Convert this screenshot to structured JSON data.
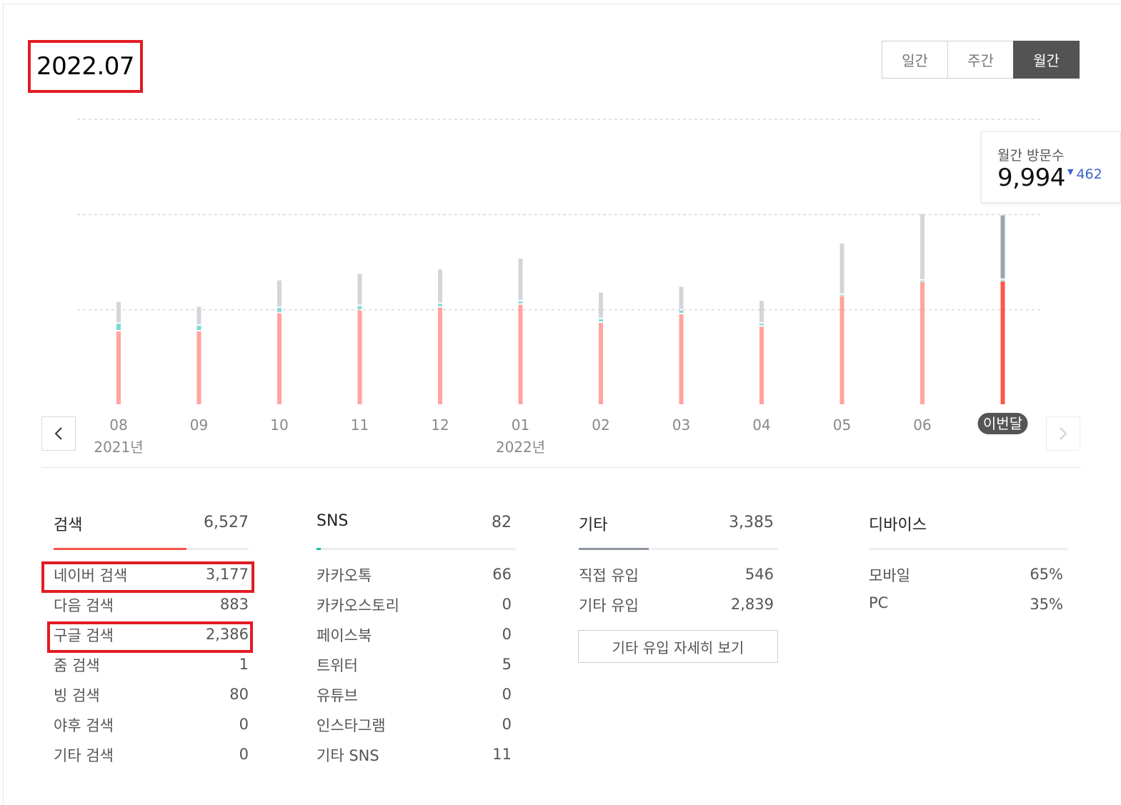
{
  "header": {
    "period": "2022.07",
    "tabs": [
      "일간",
      "주간",
      "월간"
    ],
    "active_tab": "월간"
  },
  "tooltip": {
    "title": "월간 방문수",
    "value": "9,994",
    "delta": "462"
  },
  "chart_data": {
    "type": "bar",
    "categories": [
      "08",
      "09",
      "10",
      "11",
      "12",
      "01",
      "02",
      "03",
      "04",
      "05",
      "06",
      "이번달"
    ],
    "year_labels": [
      {
        "text": "2021년",
        "category": "08"
      },
      {
        "text": "2022년",
        "category": "01"
      }
    ],
    "series": [
      {
        "key": "search",
        "color": "#ffa49e",
        "color_current": "#ff5549",
        "values": [
          3900,
          3900,
          4850,
          5000,
          5150,
          5300,
          4350,
          4800,
          4150,
          5750,
          6500,
          6527
        ]
      },
      {
        "key": "sns",
        "color": "#7ed8d4",
        "color_current": "#3dc9c1",
        "values": [
          400,
          300,
          280,
          230,
          200,
          170,
          190,
          200,
          160,
          70,
          70,
          82
        ]
      },
      {
        "key": "etc",
        "color": "#d2d6db",
        "color_current": "#9ba6b2",
        "values": [
          1150,
          1000,
          1450,
          1700,
          1800,
          2250,
          1400,
          1250,
          1200,
          2700,
          3500,
          3385
        ]
      }
    ],
    "current_index": 11,
    "ylim": [
      0,
      15000
    ],
    "grid_lines": [
      5000,
      10000,
      15000
    ],
    "grid": true
  },
  "categories": [
    {
      "name": "검색",
      "total": "6,527",
      "bar_color": "#f4544a",
      "bar_fraction": 0.68,
      "rows": [
        {
          "label": "네이버 검색",
          "value": "3,177"
        },
        {
          "label": "다음 검색",
          "value": "883"
        },
        {
          "label": "구글 검색",
          "value": "2,386"
        },
        {
          "label": "줌 검색",
          "value": "1"
        },
        {
          "label": "빙 검색",
          "value": "80"
        },
        {
          "label": "야후 검색",
          "value": "0"
        },
        {
          "label": "기타 검색",
          "value": "0"
        }
      ]
    },
    {
      "name": "SNS",
      "total": "82",
      "bar_color": "#1bbfa7",
      "bar_fraction": 0.022,
      "rows": [
        {
          "label": "카카오톡",
          "value": "66"
        },
        {
          "label": "카카오스토리",
          "value": "0"
        },
        {
          "label": "페이스북",
          "value": "0"
        },
        {
          "label": "트위터",
          "value": "5"
        },
        {
          "label": "유튜브",
          "value": "0"
        },
        {
          "label": "인스타그램",
          "value": "0"
        },
        {
          "label": "기타 SNS",
          "value": "11"
        }
      ]
    },
    {
      "name": "기타",
      "total": "3,385",
      "bar_color": "#8c949f",
      "bar_fraction": 0.35,
      "rows": [
        {
          "label": "직접 유입",
          "value": "546"
        },
        {
          "label": "기타 유입",
          "value": "2,839"
        }
      ],
      "button": "기타 유입 자세히 보기"
    },
    {
      "name": "디바이스",
      "total": "",
      "rows": [
        {
          "label": "모바일",
          "value": "65%"
        },
        {
          "label": "PC",
          "value": "35%"
        }
      ]
    }
  ]
}
